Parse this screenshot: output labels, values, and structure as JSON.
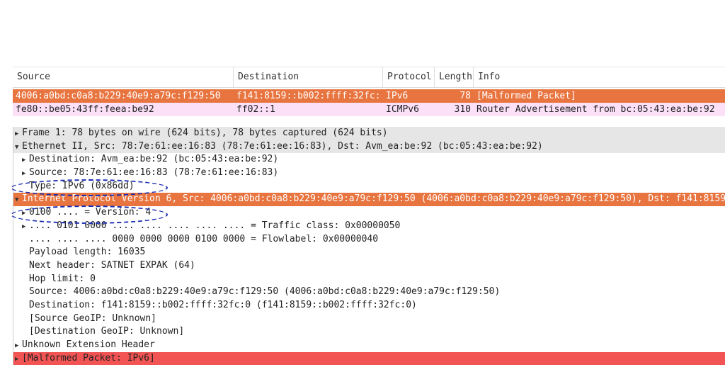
{
  "columns": [
    "Source",
    "Destination",
    "Protocol",
    "Length",
    "Info"
  ],
  "packets": [
    {
      "source": "4006:a0bd:c0a8:b229:40e9:a79c:f129:50",
      "destination": "f141:8159::b002:ffff:32fc:",
      "protocol": "IPv6",
      "length": "78",
      "info": "[Malformed Packet]",
      "selected": true
    },
    {
      "source": "fe80::be05:43ff:feea:be92",
      "destination": "ff02::1",
      "protocol": "ICMPv6",
      "length": "310",
      "info": "Router Advertisement from bc:05:43:ea:be:92",
      "selected": false
    }
  ],
  "tree": [
    {
      "text": "Frame 1: 78 bytes on wire (624 bits), 78 bytes captured (624 bits)",
      "toggle": "▶"
    },
    {
      "text": "Ethernet II, Src: 78:7e:61:ee:16:83 (78:7e:61:ee:16:83), Dst: Avm_ea:be:92 (bc:05:43:ea:be:92)",
      "toggle": "▼"
    },
    {
      "text": "Destination: Avm_ea:be:92 (bc:05:43:ea:be:92)",
      "toggle": "▶"
    },
    {
      "text": "Source: 78:7e:61:ee:16:83 (78:7e:61:ee:16:83)",
      "toggle": "▶"
    },
    {
      "text": "Type: IPv6 (0x86dd)",
      "toggle": ""
    },
    {
      "text": "Internet Protocol Version 6, Src: 4006:a0bd:c0a8:b229:40e9:a79c:f129:50 (4006:a0bd:c0a8:b229:40e9:a79c:f129:50), Dst: f141:8159::b002:ffff:32fc:0",
      "toggle": "▼"
    },
    {
      "text": "0100 .... = Version: 4",
      "toggle": "▶"
    },
    {
      "text": ".... 0101 0000 .... .... .... .... .... = Traffic class: 0x00000050",
      "toggle": "▶"
    },
    {
      "text": ".... .... .... 0000 0000 0000 0100 0000 = Flowlabel: 0x00000040",
      "toggle": ""
    },
    {
      "text": "Payload length: 16035",
      "toggle": ""
    },
    {
      "text": "Next header: SATNET EXPAK (64)",
      "toggle": ""
    },
    {
      "text": "Hop limit: 0",
      "toggle": ""
    },
    {
      "text": "Source: 4006:a0bd:c0a8:b229:40e9:a79c:f129:50 (4006:a0bd:c0a8:b229:40e9:a79c:f129:50)",
      "toggle": ""
    },
    {
      "text": "Destination: f141:8159::b002:ffff:32fc:0 (f141:8159::b002:ffff:32fc:0)",
      "toggle": ""
    },
    {
      "text": "[Source GeoIP: Unknown]",
      "toggle": ""
    },
    {
      "text": "[Destination GeoIP: Unknown]",
      "toggle": ""
    },
    {
      "text": "Unknown Extension Header",
      "toggle": "▶"
    },
    {
      "text": "[Malformed Packet: IPv6]",
      "toggle": "▶"
    }
  ],
  "colors": {
    "selected": "#e8743f",
    "icmp": "#fbe0f8",
    "malformed": "#f25454",
    "annotation": "#1a2bb0"
  }
}
